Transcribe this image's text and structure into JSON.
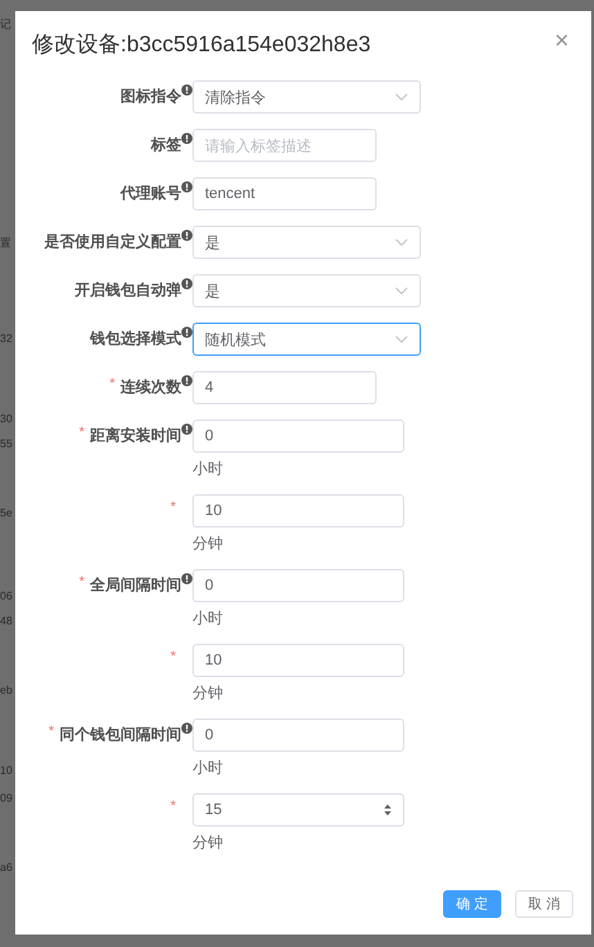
{
  "backdrop": {
    "fragments": [
      "记",
      "置",
      "32",
      "30",
      "55",
      "5e",
      "06",
      "48",
      "eb",
      "10",
      "09",
      "a6"
    ]
  },
  "dialog": {
    "title": "修改设备:b3cc5916a154e032h8e3",
    "close": "×"
  },
  "fields": [
    {
      "kind": "select",
      "label": "图标指令",
      "required": false,
      "info": true,
      "value": "清除指令",
      "focused": false
    },
    {
      "kind": "input",
      "label": "标签",
      "required": false,
      "info": true,
      "placeholder": "请输入标签描述",
      "focused": false
    },
    {
      "kind": "input",
      "label": "代理账号",
      "required": false,
      "info": true,
      "value": "tencent",
      "focused": false
    },
    {
      "kind": "select",
      "label": "是否使用自定义配置",
      "required": false,
      "info": true,
      "value": "是",
      "focused": false
    },
    {
      "kind": "select",
      "label": "开启钱包自动弹",
      "required": false,
      "info": true,
      "value": "是",
      "focused": false
    },
    {
      "kind": "select",
      "label": "钱包选择模式",
      "required": false,
      "info": true,
      "value": "随机模式",
      "focused": true
    },
    {
      "kind": "input",
      "label": "连续次数",
      "required": true,
      "required_mark": "*",
      "info": true,
      "value": "4",
      "focused": false
    },
    {
      "kind": "number",
      "label": "距离安装时间",
      "required": true,
      "required_mark": "*",
      "info": true,
      "value": "0",
      "unit": "小时",
      "spinner": false,
      "focused": false
    },
    {
      "kind": "number",
      "required": true,
      "required_mark": "*",
      "info": false,
      "value": "10",
      "unit": "分钟",
      "spinner": false,
      "focused": false
    },
    {
      "kind": "number",
      "label": "全局间隔时间",
      "required": true,
      "required_mark": "*",
      "info": true,
      "value": "0",
      "unit": "小时",
      "spinner": false,
      "focused": false
    },
    {
      "kind": "number",
      "required": true,
      "required_mark": "*",
      "info": false,
      "value": "10",
      "unit": "分钟",
      "spinner": false,
      "focused": false
    },
    {
      "kind": "number",
      "label": "同个钱包间隔时间",
      "required": true,
      "required_mark": "*",
      "info": true,
      "value": "0",
      "unit": "小时",
      "spinner": false,
      "focused": false
    },
    {
      "kind": "number",
      "required": true,
      "required_mark": "*",
      "info": false,
      "value": "15",
      "unit": "分钟",
      "spinner": true,
      "focused": false
    }
  ],
  "buttons": [
    {
      "label": "确 定",
      "primary": true
    },
    {
      "label": "取 消",
      "primary": false
    }
  ]
}
